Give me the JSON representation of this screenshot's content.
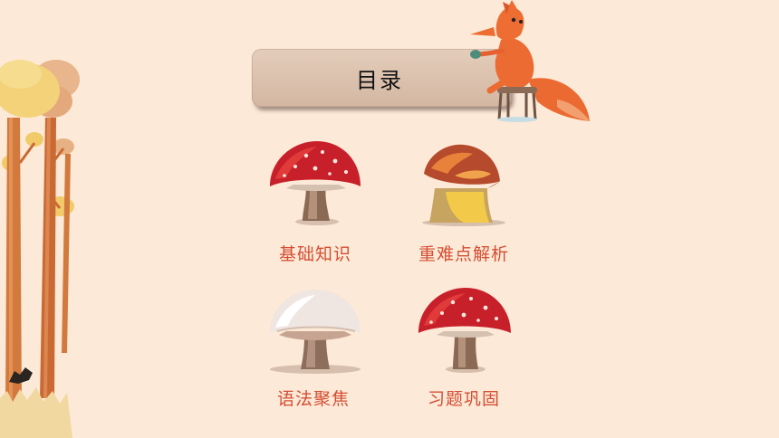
{
  "title": "目录",
  "menu": {
    "items": [
      {
        "label": "基础知识",
        "icon": "red-mushroom-icon"
      },
      {
        "label": "重难点解析",
        "icon": "yellow-mushroom-icon"
      },
      {
        "label": "语法聚焦",
        "icon": "white-mushroom-icon"
      },
      {
        "label": "习题巩固",
        "icon": "red-mushroom-icon"
      }
    ]
  },
  "colors": {
    "background": "#fde9d7",
    "banner": "#dcc3af",
    "label": "#d44e33",
    "mushroom_red": "#c8202a",
    "fox": "#e8642f"
  }
}
